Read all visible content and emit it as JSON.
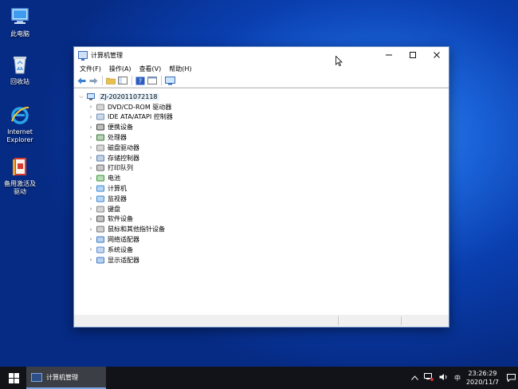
{
  "desktop": {
    "icons": [
      {
        "label": "此电脑",
        "icon": "computer-icon"
      },
      {
        "label": "回收站",
        "icon": "recycle-bin-icon"
      },
      {
        "label": "Internet Explorer",
        "icon": "ie-icon"
      },
      {
        "label": "备用激活及驱动",
        "icon": "package-icon"
      }
    ]
  },
  "window": {
    "title": "计算机管理",
    "menu": [
      "文件(F)",
      "操作(A)",
      "查看(V)",
      "帮助(H)"
    ],
    "root_label": "ZJ-202011072118",
    "tree_items": [
      {
        "label": "DVD/CD-ROM 驱动器",
        "icon": "dvd-drive-icon"
      },
      {
        "label": "IDE ATA/ATAPI 控制器",
        "icon": "ide-controller-icon"
      },
      {
        "label": "便携设备",
        "icon": "portable-device-icon"
      },
      {
        "label": "处理器",
        "icon": "processor-icon"
      },
      {
        "label": "磁盘驱动器",
        "icon": "disk-drive-icon"
      },
      {
        "label": "存储控制器",
        "icon": "storage-controller-icon"
      },
      {
        "label": "打印队列",
        "icon": "printer-icon"
      },
      {
        "label": "电池",
        "icon": "battery-icon"
      },
      {
        "label": "计算机",
        "icon": "computer-icon"
      },
      {
        "label": "监视器",
        "icon": "monitor-icon"
      },
      {
        "label": "键盘",
        "icon": "keyboard-icon"
      },
      {
        "label": "软件设备",
        "icon": "software-device-icon"
      },
      {
        "label": "鼠标和其他指针设备",
        "icon": "mouse-icon"
      },
      {
        "label": "网络适配器",
        "icon": "network-adapter-icon"
      },
      {
        "label": "系统设备",
        "icon": "system-device-icon"
      },
      {
        "label": "显示适配器",
        "icon": "display-adapter-icon"
      }
    ]
  },
  "taskbar": {
    "app_label": "计算机管理",
    "ime": "中",
    "time": "23:26:29",
    "date": "2020/11/7"
  }
}
